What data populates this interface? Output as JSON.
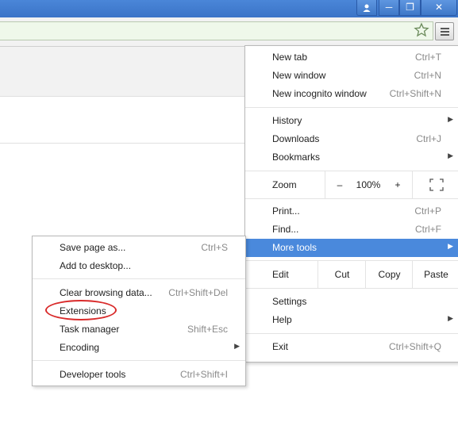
{
  "window": {
    "buttons": {
      "minimize": "─",
      "maximize": "❐",
      "close": "✕"
    }
  },
  "main_menu": {
    "items": [
      {
        "label": "New tab",
        "shortcut": "Ctrl+T"
      },
      {
        "label": "New window",
        "shortcut": "Ctrl+N"
      },
      {
        "label": "New incognito window",
        "shortcut": "Ctrl+Shift+N"
      },
      {
        "label": "History"
      },
      {
        "label": "Downloads",
        "shortcut": "Ctrl+J"
      },
      {
        "label": "Bookmarks"
      },
      {
        "label": "Print...",
        "shortcut": "Ctrl+P"
      },
      {
        "label": "Find...",
        "shortcut": "Ctrl+F"
      },
      {
        "label": "More tools"
      },
      {
        "label": "Settings"
      },
      {
        "label": "Help"
      },
      {
        "label": "Exit",
        "shortcut": "Ctrl+Shift+Q"
      }
    ],
    "zoom": {
      "label": "Zoom",
      "minus": "–",
      "value": "100%",
      "plus": "+"
    },
    "edit": {
      "label": "Edit",
      "cut": "Cut",
      "copy": "Copy",
      "paste": "Paste"
    }
  },
  "more_tools_menu": {
    "items": [
      {
        "label": "Save page as...",
        "shortcut": "Ctrl+S"
      },
      {
        "label": "Add to desktop..."
      },
      {
        "label": "Clear browsing data...",
        "shortcut": "Ctrl+Shift+Del"
      },
      {
        "label": "Extensions"
      },
      {
        "label": "Task manager",
        "shortcut": "Shift+Esc"
      },
      {
        "label": "Encoding"
      },
      {
        "label": "Developer tools",
        "shortcut": "Ctrl+Shift+I"
      }
    ]
  },
  "colors": {
    "highlight": "#4a89dc",
    "annotation": "#d92b2b",
    "titlebar": "#3b74c7"
  }
}
